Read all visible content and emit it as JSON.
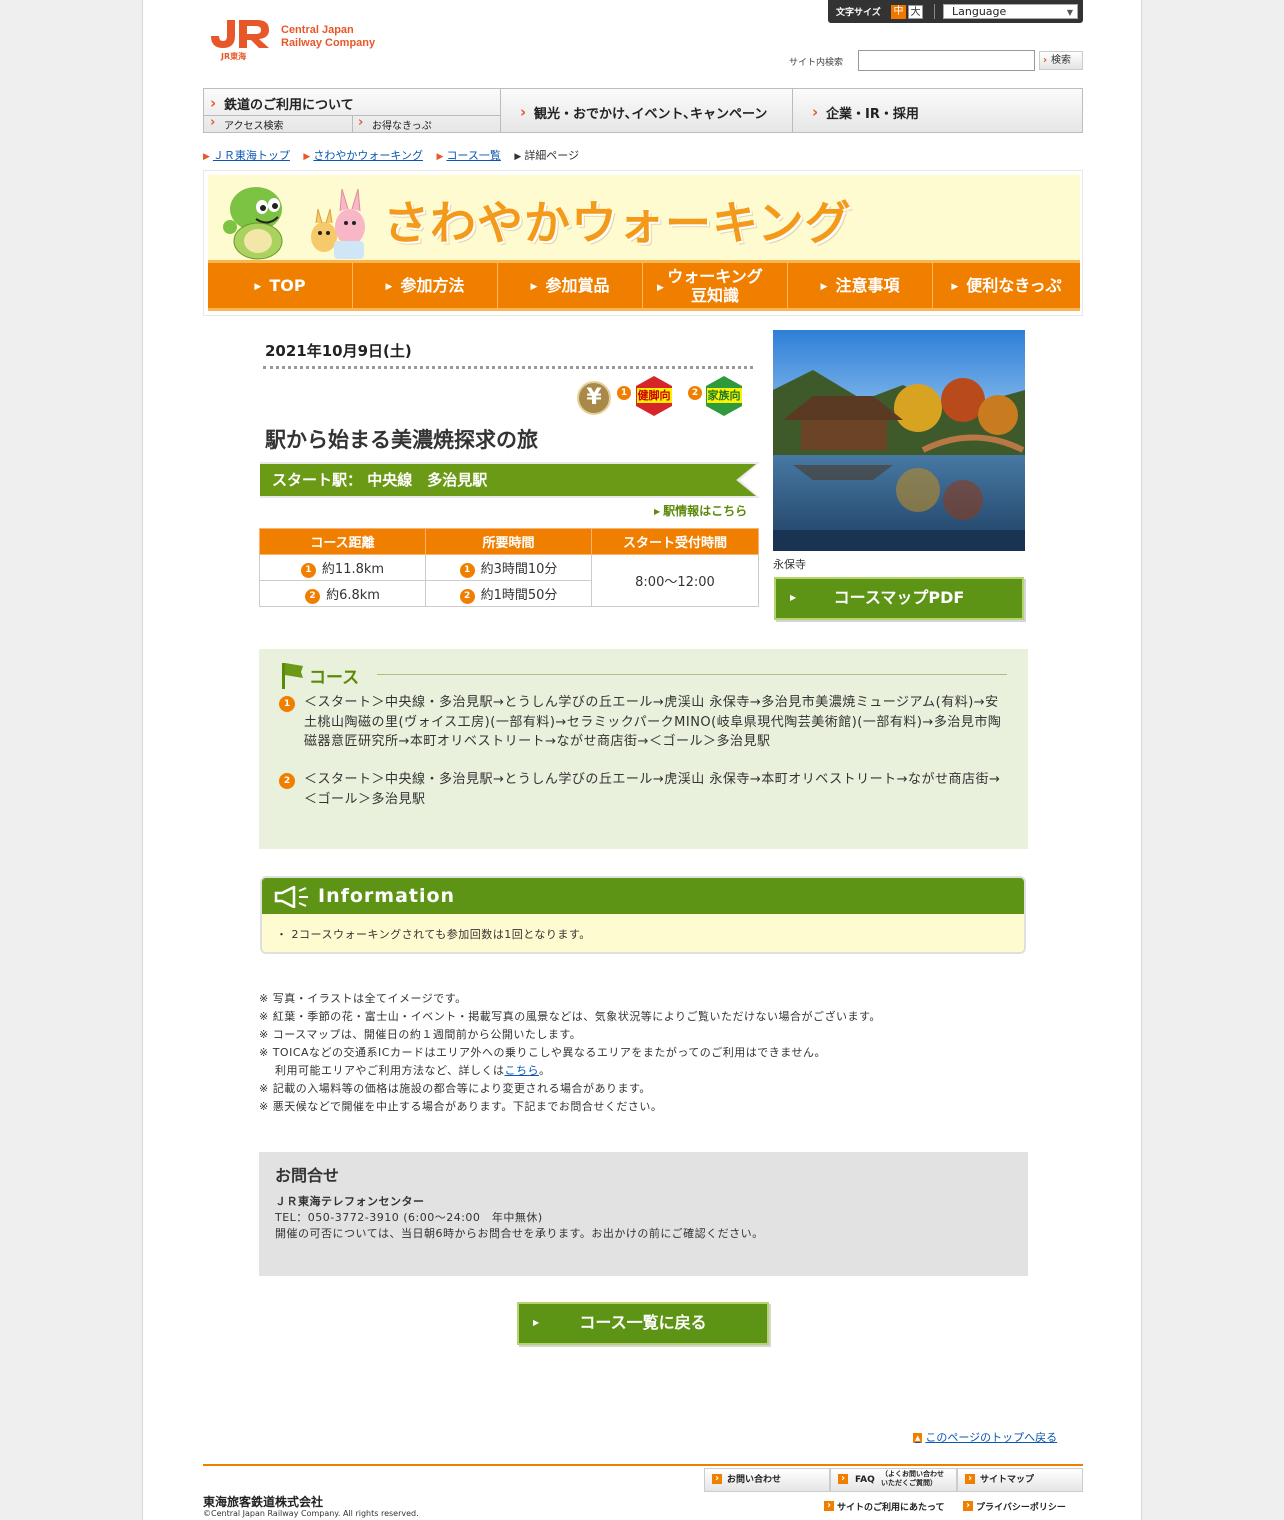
{
  "header": {
    "logo_sub": "JR東海",
    "logo_text": [
      "Central Japan",
      "Railway Company"
    ],
    "font_size_label": "文字サイズ",
    "font_size_mid": "中",
    "font_size_big": "大",
    "language_label": "Language",
    "search_label": "サイト内検索",
    "search_value": "",
    "search_button": "検索"
  },
  "gnav": {
    "railway": "鉄道のご利用について",
    "access": "アクセス検索",
    "tickets": "お得なきっぷ",
    "tourism": "観光・おでかけ､イベント､キャンペーン",
    "corporate": "企業・IR・採用"
  },
  "breadcrumb": [
    "ＪＲ東海トップ",
    "さわやかウォーキング",
    "コース一覧",
    "詳細ページ"
  ],
  "banner": {
    "title": "さわやかウォーキング",
    "menu": [
      "TOP",
      "参加方法",
      "参加賞品",
      "ウォーキング",
      "豆知識",
      "注意事項",
      "便利なきっぷ"
    ]
  },
  "event": {
    "date": "2021年10月9日(土)",
    "yen_icon": "¥",
    "badge1_num": "1",
    "badge1_label": "健脚向",
    "badge2_num": "2",
    "badge2_label": "家族向",
    "title": "駅から始まる美濃焼探求の旅",
    "start_station": "スタート駅： 中央線　多治見駅",
    "station_link": "駅情報はこちら",
    "table_headers": [
      "コース距離",
      "所要時間",
      "スタート受付時間"
    ],
    "rows": [
      {
        "num": "1",
        "distance": "約11.8km",
        "time": "約3時間10分"
      },
      {
        "num": "2",
        "distance": "約6.8km",
        "time": "約1時間50分"
      }
    ],
    "reception": "8:00～12:00",
    "photo_caption": "永保寺",
    "map_button": "コースマップPDF"
  },
  "course": {
    "title": "コース",
    "routes": [
      {
        "num": "1",
        "text": "＜スタート＞中央線・多治見駅→とうしん学びの丘エール→虎渓山 永保寺→多治見市美濃焼ミュージアム(有料)→安土桃山陶磁の里(ヴォイス工房)(一部有料)→セラミックパークMINO(岐阜県現代陶芸美術館)(一部有料)→多治見市陶磁器意匠研究所→本町オリベストリート→ながせ商店街→＜ゴール＞多治見駅"
      },
      {
        "num": "2",
        "text": "＜スタート＞中央線・多治見駅→とうしん学びの丘エール→虎渓山 永保寺→本町オリベストリート→ながせ商店街→＜ゴール＞多治見駅"
      }
    ]
  },
  "information": {
    "title": "Information",
    "text": "・ 2コースウォーキングされても参加回数は1回となります。"
  },
  "notes": [
    "※ 写真・イラストは全てイメージです。",
    "※ 紅葉・季節の花・富士山・イベント・掲載写真の風景などは、気象状況等によりご覧いただけない場合がございます。",
    "※ コースマップは、開催日の約１週間前から公開いたします。",
    "※ TOICAなどの交通系ICカードはエリア外への乗りこしや異なるエリアをまたがってのご利用はできません。"
  ],
  "notes_ic_line2": "利用可能エリアやご利用方法など、詳しくは",
  "notes_ic_link": "こちら",
  "notes_ic_end": "。",
  "notes_after": [
    "※ 記載の入場料等の価格は施設の都合等により変更される場合があります。",
    "※ 悪天候などで開催を中止する場合があります。下記までお問合せください。"
  ],
  "contact": {
    "title": "お問合せ",
    "center": "ＪＲ東海テレフォンセンター",
    "tel": "TEL：050-3772-3910 (6:00～24:00　年中無休)",
    "note": "開催の可否については、当日朝6時からお問合せを承ります。お出かけの前にご確認ください。"
  },
  "back_button": "コース一覧に戻る",
  "page_top": "このページのトップへ戻る",
  "footer": {
    "contact": "お問い合わせ",
    "faq": "FAQ",
    "faq_sub1": "（よくお問い合わせ",
    "faq_sub2": "いただくご質問）",
    "sitemap": "サイトマップ",
    "terms": "サイトのご利用にあたって",
    "privacy": "プライバシーポリシー",
    "corp": "東海旅客鉄道株式会社",
    "copyright": "©Central Japan Railway Company.  All rights reserved."
  },
  "colors": {
    "accent_orange": "#f07f00",
    "accent_green": "#5e9415",
    "brand_jr": "#e8572a"
  }
}
